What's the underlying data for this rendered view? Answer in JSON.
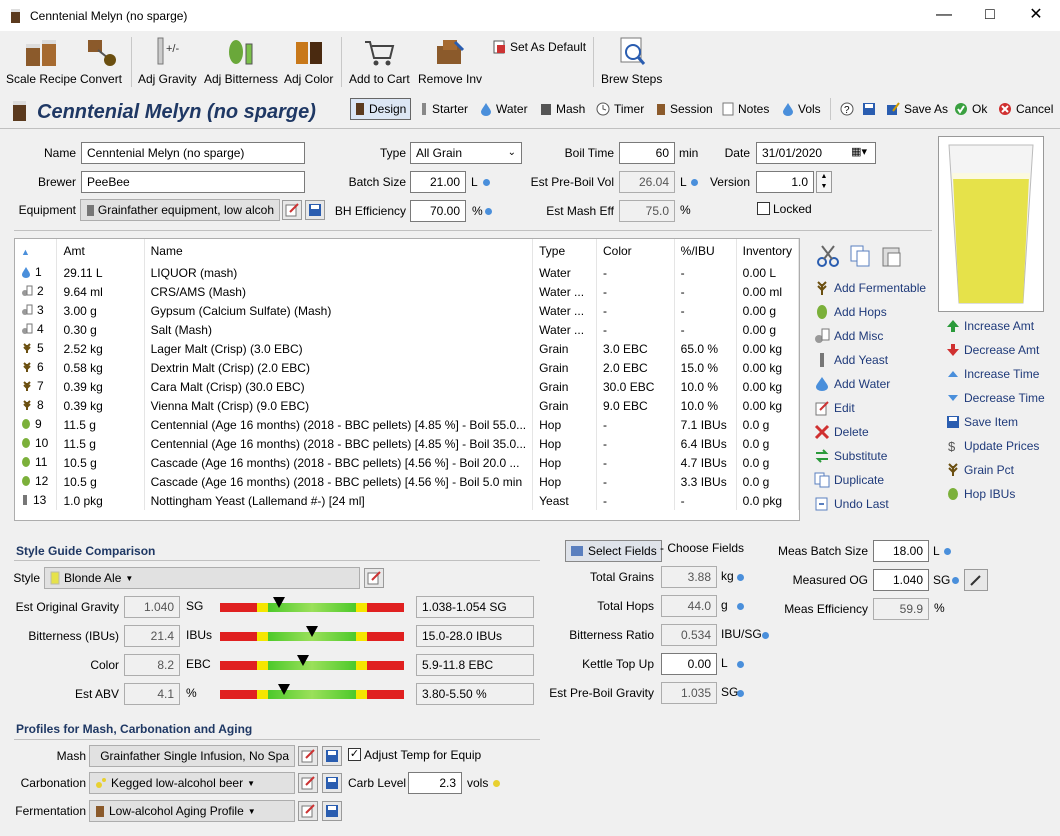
{
  "window": {
    "title": "Cenntenial Melyn (no sparge)"
  },
  "toolbar": [
    {
      "label": "Scale Recipe"
    },
    {
      "label": "Convert"
    },
    {
      "label": "Adj Gravity"
    },
    {
      "label": "Adj Bitterness"
    },
    {
      "label": "Adj Color"
    },
    {
      "label": "Add to Cart"
    },
    {
      "label": "Remove Inv"
    },
    {
      "label": "Set As Default"
    },
    {
      "label": "Brew Steps"
    }
  ],
  "recipe_title": "Cenntenial Melyn (no sparge)",
  "tabs": {
    "design": "Design",
    "starter": "Starter",
    "water": "Water",
    "mash": "Mash",
    "timer": "Timer",
    "session": "Session",
    "notes": "Notes",
    "vols": "Vols",
    "save_as": "Save As",
    "ok": "Ok",
    "cancel": "Cancel"
  },
  "form": {
    "name_label": "Name",
    "name": "Cenntenial Melyn (no sparge)",
    "brewer_label": "Brewer",
    "brewer": "PeeBee",
    "equipment_label": "Equipment",
    "equipment": "Grainfather equipment, low alcoh",
    "type_label": "Type",
    "type": "All Grain",
    "batch_label": "Batch Size",
    "batch": "21.00",
    "batch_unit": "L",
    "bh_label": "BH Efficiency",
    "bh": "70.00",
    "bh_unit": "%",
    "boil_label": "Boil Time",
    "boil": "60",
    "boil_unit": "min",
    "preboil_label": "Est Pre-Boil Vol",
    "preboil": "26.04",
    "preboil_unit": "L",
    "mash_eff_label": "Est Mash Eff",
    "mash_eff": "75.0",
    "mash_eff_unit": "%",
    "date_label": "Date",
    "date": "31/01/2020",
    "version_label": "Version",
    "version": "1.0",
    "locked_label": "Locked"
  },
  "grid": {
    "headers": [
      "Amt",
      "Name",
      "Type",
      "Color",
      "%/IBU",
      "Inventory"
    ],
    "rows": [
      {
        "n": "1",
        "amt": "29.11 L",
        "name": "LIQUOR (mash)",
        "type": "Water",
        "color": "-",
        "ibu": "-",
        "inv": "0.00 L",
        "icon": "water"
      },
      {
        "n": "2",
        "amt": "9.64 ml",
        "name": "CRS/AMS (Mash)",
        "type": "Water ...",
        "color": "-",
        "ibu": "-",
        "inv": "0.00 ml",
        "icon": "misc"
      },
      {
        "n": "3",
        "amt": "3.00 g",
        "name": "Gypsum (Calcium Sulfate) (Mash)",
        "type": "Water ...",
        "color": "-",
        "ibu": "-",
        "inv": "0.00 g",
        "icon": "misc"
      },
      {
        "n": "4",
        "amt": "0.30 g",
        "name": "Salt (Mash)",
        "type": "Water ...",
        "color": "-",
        "ibu": "-",
        "inv": "0.00 g",
        "icon": "misc"
      },
      {
        "n": "5",
        "amt": "2.52 kg",
        "name": "Lager Malt (Crisp) (3.0 EBC)",
        "type": "Grain",
        "color": "3.0 EBC",
        "ibu": "65.0 %",
        "inv": "0.00 kg",
        "icon": "grain"
      },
      {
        "n": "6",
        "amt": "0.58 kg",
        "name": "Dextrin Malt (Crisp) (2.0 EBC)",
        "type": "Grain",
        "color": "2.0 EBC",
        "ibu": "15.0 %",
        "inv": "0.00 kg",
        "icon": "grain"
      },
      {
        "n": "7",
        "amt": "0.39 kg",
        "name": "Cara Malt (Crisp) (30.0 EBC)",
        "type": "Grain",
        "color": "30.0 EBC",
        "ibu": "10.0 %",
        "inv": "0.00 kg",
        "icon": "grain"
      },
      {
        "n": "8",
        "amt": "0.39 kg",
        "name": "Vienna Malt (Crisp) (9.0 EBC)",
        "type": "Grain",
        "color": "9.0 EBC",
        "ibu": "10.0 %",
        "inv": "0.00 kg",
        "icon": "grain"
      },
      {
        "n": "9",
        "amt": "11.5 g",
        "name": "Centennial (Age 16 months) (2018 - BBC pellets) [4.85 %] - Boil 55.0...",
        "type": "Hop",
        "color": "-",
        "ibu": "7.1 IBUs",
        "inv": "0.0 g",
        "icon": "hop"
      },
      {
        "n": "10",
        "amt": "11.5 g",
        "name": "Centennial (Age 16 months) (2018 - BBC pellets) [4.85 %] - Boil 35.0...",
        "type": "Hop",
        "color": "-",
        "ibu": "6.4 IBUs",
        "inv": "0.0 g",
        "icon": "hop"
      },
      {
        "n": "11",
        "amt": "10.5 g",
        "name": "Cascade (Age 16 months) (2018 - BBC pellets) [4.56 %] - Boil 20.0 ...",
        "type": "Hop",
        "color": "-",
        "ibu": "4.7 IBUs",
        "inv": "0.0 g",
        "icon": "hop"
      },
      {
        "n": "12",
        "amt": "10.5 g",
        "name": "Cascade (Age 16 months) (2018 - BBC pellets) [4.56 %] - Boil 5.0 min",
        "type": "Hop",
        "color": "-",
        "ibu": "3.3 IBUs",
        "inv": "0.0 g",
        "icon": "hop"
      },
      {
        "n": "13",
        "amt": "1.0 pkg",
        "name": "Nottingham Yeast (Lallemand #-) [24 ml]",
        "type": "Yeast",
        "color": "-",
        "ibu": "-",
        "inv": "0.0 pkg",
        "icon": "yeast"
      }
    ]
  },
  "actions": [
    "Add Fermentable",
    "Add Hops",
    "Add Misc",
    "Add Yeast",
    "Add Water",
    "Edit",
    "Delete",
    "Substitute",
    "Duplicate",
    "Undo Last"
  ],
  "actions2": [
    "Increase Amt",
    "Decrease Amt",
    "Increase Time",
    "Decrease Time",
    "Save Item",
    "Update Prices",
    "Grain Pct",
    "Hop IBUs"
  ],
  "style": {
    "section": "Style Guide Comparison",
    "style_label": "Style",
    "style_name": "Blonde Ale",
    "rows": [
      {
        "label": "Est Original Gravity",
        "value": "1.040",
        "unit": "SG",
        "range": "1.038-1.054 SG",
        "marker": 0.32
      },
      {
        "label": "Bitterness (IBUs)",
        "value": "21.4",
        "unit": "IBUs",
        "range": "15.0-28.0 IBUs",
        "marker": 0.5
      },
      {
        "label": "Color",
        "value": "8.2",
        "unit": "EBC",
        "range": "5.9-11.8 EBC",
        "marker": 0.45
      },
      {
        "label": "Est ABV",
        "value": "4.1",
        "unit": "%",
        "range": "3.80-5.50 %",
        "marker": 0.35
      }
    ]
  },
  "fields": {
    "select_btn": "Select Fields",
    "choose": "- Choose Fields",
    "rows": [
      {
        "label": "Total Grains",
        "value": "3.88",
        "unit": "kg"
      },
      {
        "label": "Total Hops",
        "value": "44.0",
        "unit": "g"
      },
      {
        "label": "Bitterness Ratio",
        "value": "0.534",
        "unit": "IBU/SG"
      },
      {
        "label": "Kettle Top Up",
        "value": "0.00",
        "unit": "L"
      },
      {
        "label": "Est Pre-Boil Gravity",
        "value": "1.035",
        "unit": "SG"
      }
    ]
  },
  "meas": {
    "batch_label": "Meas Batch Size",
    "batch": "18.00",
    "batch_unit": "L",
    "og_label": "Measured OG",
    "og": "1.040",
    "og_unit": "SG",
    "eff_label": "Meas Efficiency",
    "eff": "59.9",
    "eff_unit": "%"
  },
  "profiles": {
    "section": "Profiles for Mash, Carbonation and Aging",
    "mash_label": "Mash",
    "mash": "Grainfather Single Infusion, No Spa",
    "adjust_label": "Adjust Temp for Equip",
    "carb_label": "Carbonation",
    "carb": "Kegged low-alcohol beer",
    "carb_level_label": "Carb Level",
    "carb_level": "2.3",
    "carb_unit": "vols",
    "ferm_label": "Fermentation",
    "ferm": "Low-alcohol Aging Profile"
  },
  "colors": {
    "beer": "#e6e24a",
    "accent": "#1f3864",
    "link": "#1f3a7a"
  }
}
